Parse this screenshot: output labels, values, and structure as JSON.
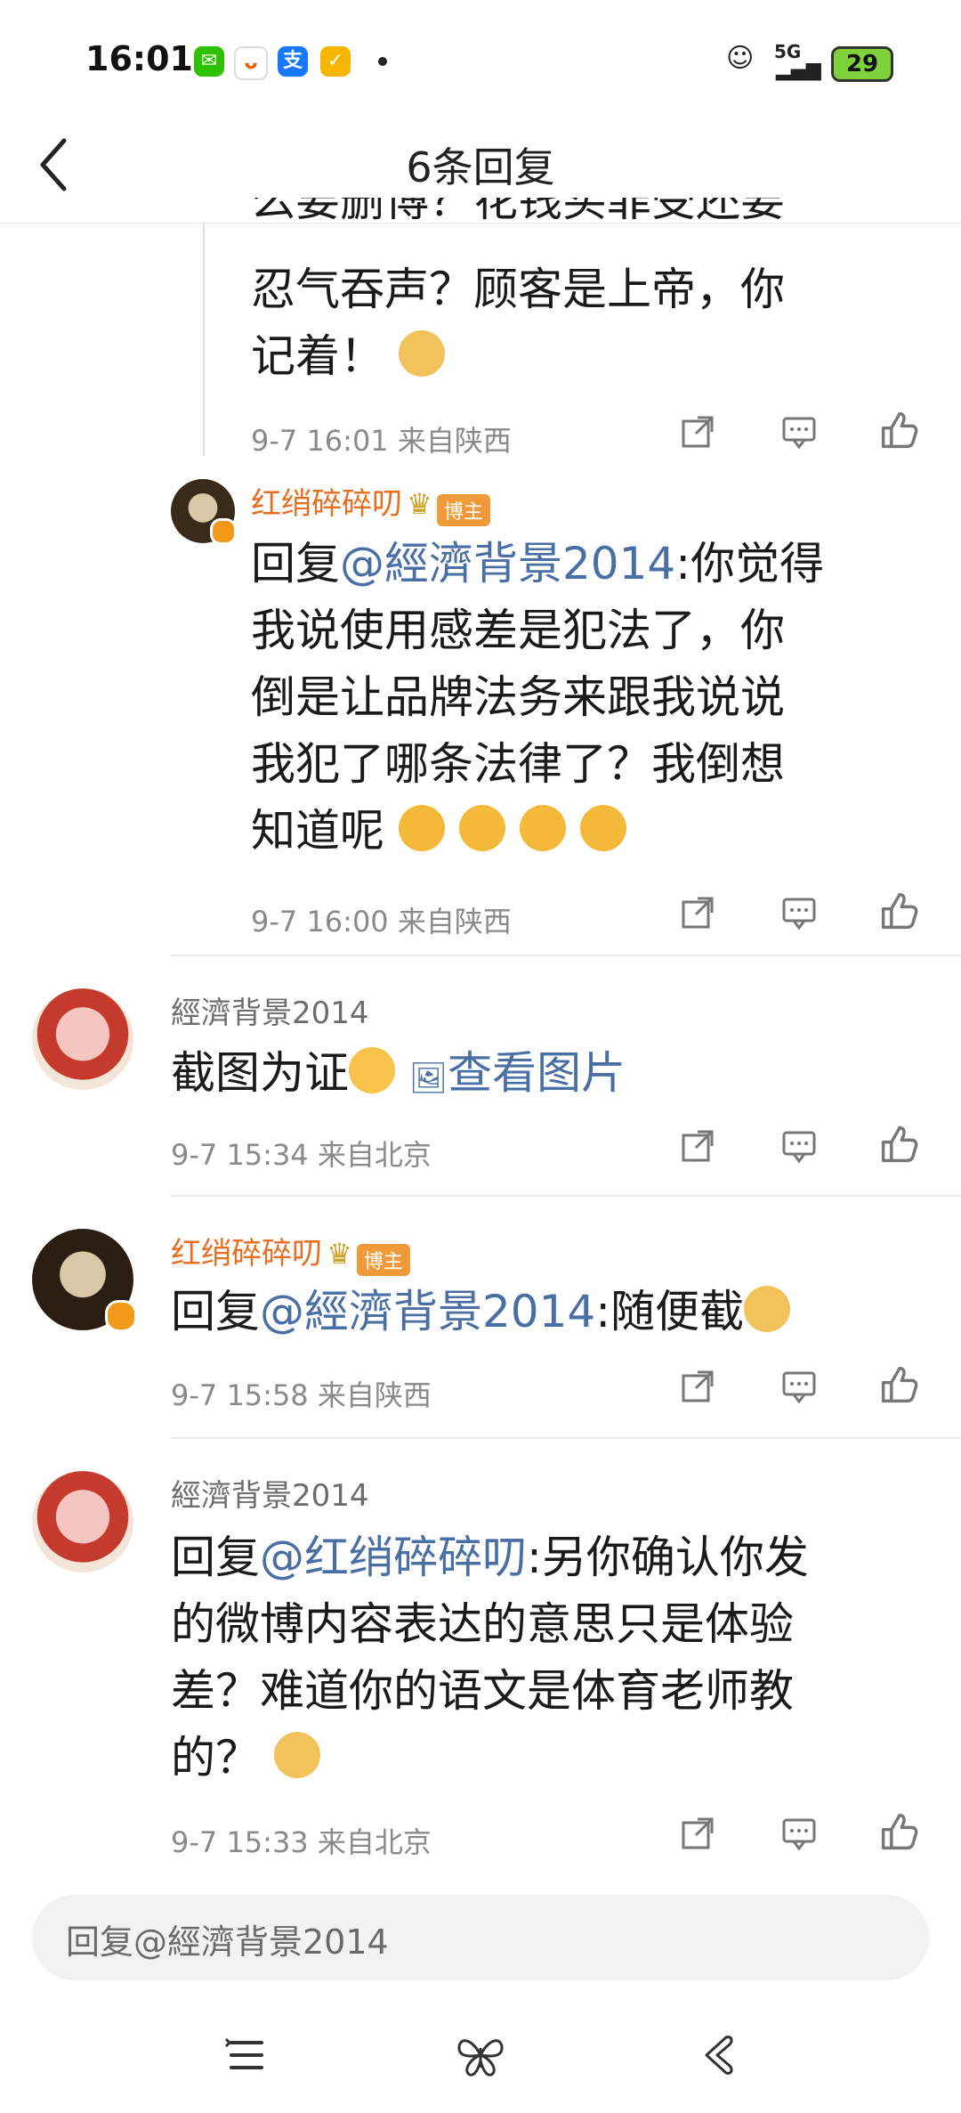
{
  "status_bar": {
    "time": "16:01",
    "net_label": "5G",
    "battery": "29",
    "app_icons": [
      {
        "name": "wechat-icon",
        "color": "#2dc100",
        "glyph": "💬"
      },
      {
        "name": "taobao-icon",
        "color": "#ffffff",
        "glyph": "ᴗ"
      },
      {
        "name": "alipay-icon",
        "color": "#1677ff",
        "glyph": "支"
      },
      {
        "name": "rewards-icon",
        "color": "#f7b500",
        "glyph": "✓"
      }
    ]
  },
  "header": {
    "title": "6条回复"
  },
  "comments": [
    {
      "text_lines": [
        "么要删博？花钱买罪受还要",
        "忍气吞声？顾客是上帝，你",
        "记着！"
      ],
      "meta": "9-7 16:01  来自陕西"
    },
    {
      "username": "红绡碎碎叨",
      "badge": "博主",
      "reply_prefix": "回复",
      "reply_at": "@經濟背景2014",
      "text_lines": [
        ":你觉得",
        "我说使用感差是犯法了，你",
        "倒是让品牌法务来跟我说说",
        "我犯了哪条法律了？我倒想",
        "知道呢"
      ],
      "meta": "9-7 16:00  来自陕西"
    },
    {
      "username": "經濟背景2014",
      "text": "截图为证",
      "image_link": "查看图片",
      "meta": "9-7 15:34  来自北京"
    },
    {
      "username": "红绡碎碎叨",
      "badge": "博主",
      "reply_prefix": "回复",
      "reply_at": "@經濟背景2014",
      "text": ":随便截",
      "meta": "9-7 15:58  来自陕西"
    },
    {
      "username": "經濟背景2014",
      "reply_prefix": "回复",
      "reply_at": "@红绡碎碎叨",
      "text_lines": [
        ":另你确认你发",
        "的微博内容表达的意思只是体验",
        "差？难道你的语文是体育老师教",
        "的？"
      ],
      "meta": "9-7 15:33  来自北京"
    }
  ],
  "reply_input": {
    "value": "回复@經濟背景2014"
  },
  "colors": {
    "accent_link": "#4a6fa5",
    "author_orange": "#e86d1f",
    "meta_gray": "#8a8a8a"
  }
}
